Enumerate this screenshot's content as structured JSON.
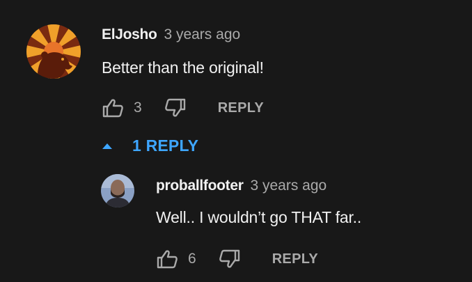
{
  "comment": {
    "author": "ElJosho",
    "time": "3 years ago",
    "text": "Better than the original!",
    "likes": "3",
    "reply_label": "REPLY",
    "avatar_icon": "sunburst-bear-avatar"
  },
  "replies_toggle": {
    "label": "1 REPLY",
    "icon": "caret-up-icon",
    "color": "#3ea6ff"
  },
  "reply": {
    "author": "proballfooter",
    "time": "3 years ago",
    "text": "Well.. I wouldn’t go THAT far..",
    "likes": "6",
    "reply_label": "REPLY",
    "avatar_icon": "person-photo-avatar"
  },
  "icons": {
    "like": "thumbs-up-icon",
    "dislike": "thumbs-down-icon"
  },
  "colors": {
    "background": "#181818",
    "text_primary": "#f1f1f1",
    "text_secondary": "#aaaaaa",
    "accent": "#3ea6ff"
  }
}
